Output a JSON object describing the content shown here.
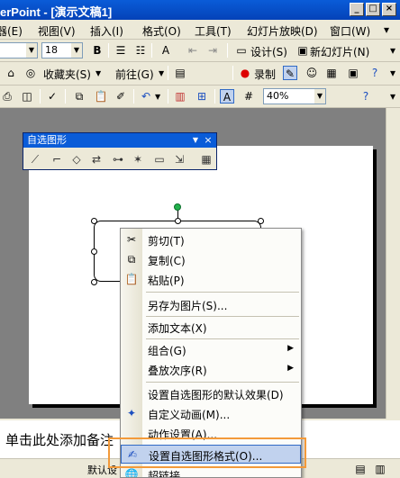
{
  "window": {
    "title": "erPoint - [演示文稿1]",
    "minimize": "_",
    "maximize": "□",
    "close": "×"
  },
  "menubar": {
    "items": [
      "器(E)",
      "视图(V)",
      "插入(I)",
      "格式(O)",
      "工具(T)",
      "幻灯片放映(D)",
      "窗口(W)"
    ],
    "overflow": "▾"
  },
  "toolbar1": {
    "font_size": "18",
    "bold": "B",
    "design_label": "设计(S)",
    "new_slide_label": "新幻灯片(N)"
  },
  "toolbar2": {
    "favorites_label": "收藏夹(S)",
    "goto_label": "前往(G)",
    "record_label": "录制"
  },
  "toolbar3": {
    "zoom": "40%"
  },
  "autoshape_toolbar": {
    "title": "自选图形"
  },
  "context_menu": {
    "items": [
      {
        "label": "剪切(T)",
        "icon": "scissors-icon"
      },
      {
        "label": "复制(C)",
        "icon": "copy-icon"
      },
      {
        "label": "粘贴(P)",
        "icon": "paste-icon"
      },
      {
        "label": "另存为图片(S)..."
      },
      {
        "label": "添加文本(X)"
      },
      {
        "label": "组合(G)",
        "submenu": true
      },
      {
        "label": "叠放次序(R)",
        "submenu": true
      },
      {
        "label": "设置自选图形的默认效果(D)"
      },
      {
        "label": "自定义动画(M)...",
        "icon": "animation-icon"
      },
      {
        "label": "动作设置(A)..."
      },
      {
        "label": "设置自选图形格式(O)...",
        "icon": "format-shape-icon",
        "highlighted": true
      },
      {
        "label": "超链接",
        "icon": "hyperlink-icon"
      }
    ]
  },
  "notes": {
    "text": "单击此处添加备注"
  },
  "statusbar": {
    "text": "默认设"
  },
  "colors": {
    "highlight_outline": "#f39a3a",
    "selected_item": "#c1d2ee",
    "title_bar": "#0a5cd8"
  }
}
